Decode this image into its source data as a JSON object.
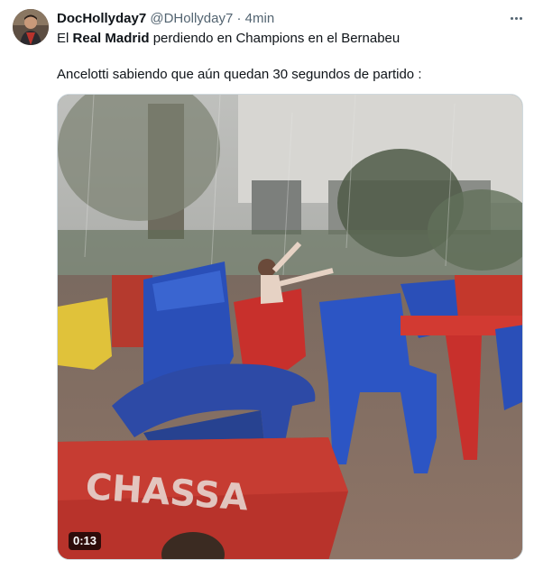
{
  "tweet": {
    "author_name": "DocHollyday7",
    "author_handle": "@DHollyday7",
    "separator": "·",
    "time": "4min",
    "text_line1_prefix": "El ",
    "text_line1_bold": "Real Madrid",
    "text_line1_suffix": " perdiendo en Champions en el Bernabeu",
    "text_line2": "Ancelotti sabiendo que aún quedan 30 segundos de partido :",
    "more_icon": "more-horizontal-icon"
  },
  "media": {
    "type": "video",
    "duration": "0:13",
    "table_sign_text": "CHASSA"
  },
  "colors": {
    "name": "#0f1419",
    "secondary": "#536471",
    "border": "#cfd9de",
    "chair_blue": "#2a4fb8",
    "chair_red": "#c8302c"
  }
}
